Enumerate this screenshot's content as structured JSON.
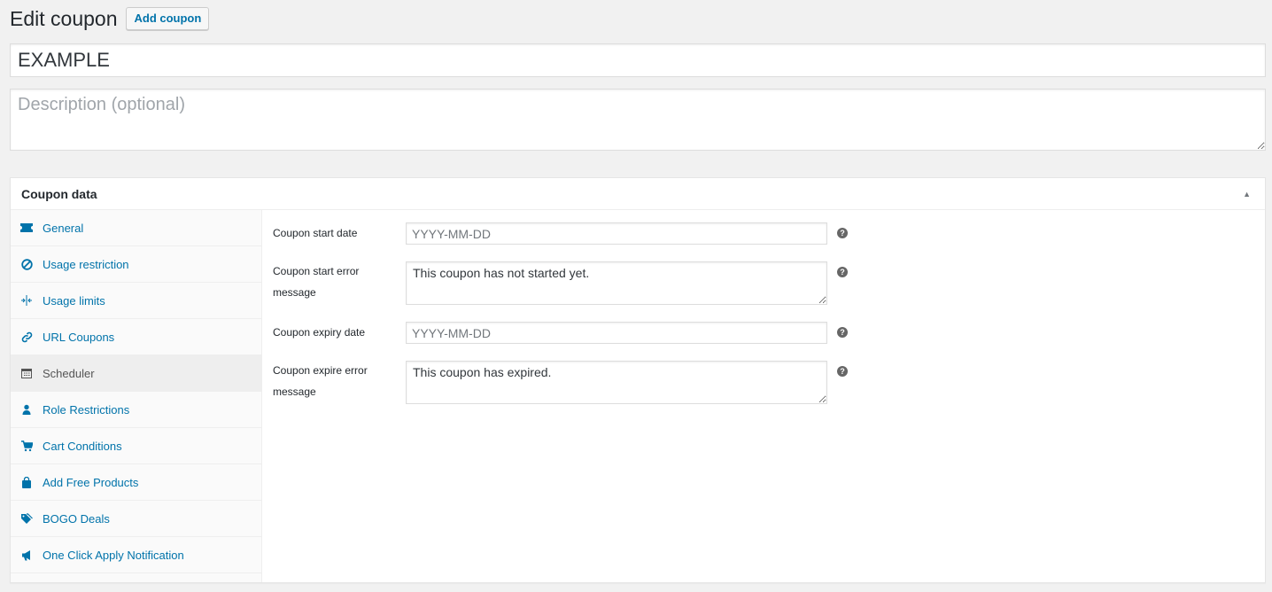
{
  "page": {
    "title": "Edit coupon",
    "add_button_label": "Add coupon"
  },
  "coupon": {
    "title_value": "EXAMPLE",
    "description_placeholder": "Description (optional)"
  },
  "postbox": {
    "title": "Coupon data",
    "toggle_icon": "arrow-up-icon"
  },
  "tabs": [
    {
      "label": "General",
      "icon": "ticket-icon",
      "active": false
    },
    {
      "label": "Usage restriction",
      "icon": "block-icon",
      "active": false
    },
    {
      "label": "Usage limits",
      "icon": "limits-icon",
      "active": false
    },
    {
      "label": "URL Coupons",
      "icon": "link-icon",
      "active": false
    },
    {
      "label": "Scheduler",
      "icon": "calendar-icon",
      "active": true
    },
    {
      "label": "Role Restrictions",
      "icon": "user-icon",
      "active": false
    },
    {
      "label": "Cart Conditions",
      "icon": "cart-icon",
      "active": false
    },
    {
      "label": "Add Free Products",
      "icon": "bag-icon",
      "active": false
    },
    {
      "label": "BOGO Deals",
      "icon": "tag-icon",
      "active": false
    },
    {
      "label": "One Click Apply Notification",
      "icon": "megaphone-icon",
      "active": false
    }
  ],
  "scheduler": {
    "start_date": {
      "label": "Coupon start date",
      "placeholder": "YYYY-MM-DD",
      "value": ""
    },
    "start_error": {
      "label": "Coupon start error message",
      "value": "This coupon has not started yet."
    },
    "expiry_date": {
      "label": "Coupon expiry date",
      "placeholder": "YYYY-MM-DD",
      "value": ""
    },
    "expire_error": {
      "label": "Coupon expire error message",
      "value": "This coupon has expired."
    },
    "help_glyph": "?"
  },
  "colors": {
    "link": "#0073aa",
    "background": "#f1f1f1",
    "active_tab": "#eeeeee"
  }
}
